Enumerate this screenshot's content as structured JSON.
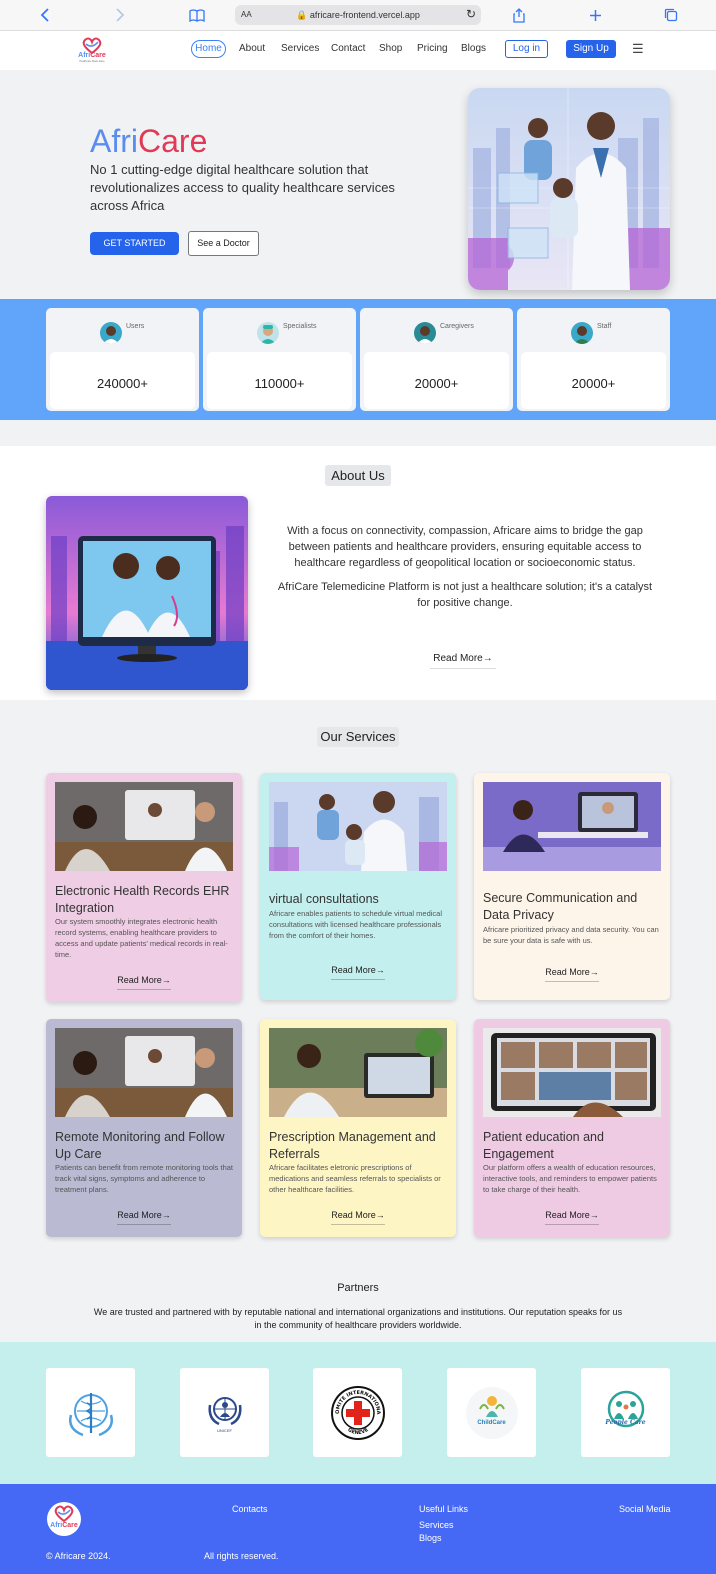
{
  "browser": {
    "text_size_label": "AA",
    "url": "africare-frontend.vercel.app"
  },
  "nav": {
    "logo_text_afri": "Afri",
    "logo_text_care": "Care",
    "logo_tagline": "Healthcare Made Easy",
    "links": [
      "Home",
      "About",
      "Services",
      "Contact",
      "Shop",
      "Pricing",
      "Blogs"
    ],
    "login_label": "Log in",
    "signup_label": "Sign Up"
  },
  "hero": {
    "brand_afri": "Afri",
    "brand_care": "Care",
    "tagline": "No 1 cutting-edge digital healthcare solution that revolutionalizes access to quality healthcare services across Africa",
    "start_label": "GET STARTED",
    "doctor_label": "See a Doctor"
  },
  "stats": [
    {
      "label": "Users",
      "value": "240000+"
    },
    {
      "label": "Specialists",
      "value": "110000+"
    },
    {
      "label": "Caregivers",
      "value": "20000+"
    },
    {
      "label": "Staff",
      "value": "20000+"
    }
  ],
  "about": {
    "title": "About Us",
    "paragraph1": "With a focus on connectivity, compassion, Africare aims to bridge the gap between patients and healthcare providers, ensuring equitable access to healthcare regardless of geopolitical location or socioeconomic status.",
    "paragraph2": "AfriCare Telemedicine Platform is not just a healthcare solution; it's a catalyst for positive change.",
    "read_more": "Read More"
  },
  "services": {
    "title": "Our Services",
    "read_more": "Read More",
    "items": [
      {
        "title": "Electronic Health Records EHR Integration",
        "desc": "Our system smoothly integrates electronic health record systems, enabling healthcare providers to access and update patients' medical records in real-time."
      },
      {
        "title": "virtual consultations",
        "desc": "Africare enables patients to schedule virtual medical consultations with licensed healthcare professionals from the comfort of their homes."
      },
      {
        "title": "Secure Communication and Data Privacy",
        "desc": "Africare prioritized privacy and data security. You can be sure your data is safe with us."
      },
      {
        "title": "Remote Monitoring and Follow Up Care",
        "desc": "Patients can benefit from remote monitoring tools that track vital signs, symptoms and adherence to treatment plans."
      },
      {
        "title": "Prescription Management and Referrals",
        "desc": "Africare facilitates eletronic prescriptions of medications and seamless referrals to specialists or other healthcare facilities."
      },
      {
        "title": "Patient education and Engagement",
        "desc": "Our platform offers a wealth of education resources, interactive tools, and reminders to empower patients to take charge of their health."
      }
    ]
  },
  "partners": {
    "title": "Partners",
    "text": "We are trusted and partnered with by reputable national and international organizations and institutions. Our reputation speaks for us in the community of healthcare providers worldwide.",
    "logos": [
      {
        "name": "WHO",
        "icon": "who-emblem-icon"
      },
      {
        "name": "UNICEF",
        "icon": "unicef-icon",
        "caption": "UNICEF"
      },
      {
        "name": "ICRC",
        "icon": "red-cross-icon",
        "ring_top": "COMITE INTERNATIONAL",
        "ring_bottom": "GENEVE"
      },
      {
        "name": "ChildCare",
        "icon": "childcare-icon",
        "caption": "ChildCare"
      },
      {
        "name": "People Care",
        "icon": "people-care-icon",
        "caption": "People Care"
      }
    ]
  },
  "footer": {
    "contacts_title": "Contacts",
    "useful_links_title": "Useful Links",
    "social_title": "Social Media",
    "links": [
      "Services",
      "Blogs"
    ],
    "copyright": "© Africare 2024.",
    "rights": "All rights reserved.",
    "logo_afri": "Afri",
    "logo_care": "Care"
  },
  "colors": {
    "primary": "#2563eb",
    "brand_blue": "#5b8dee",
    "brand_red": "#e03a56",
    "stats_band": "#60a5fa",
    "partners_band": "#c5efed",
    "footer": "#4569f5",
    "card_pink": "#efcde4",
    "card_cyan": "#c3f0ee",
    "card_cream": "#fdf4ea",
    "card_lavender": "#babad3",
    "card_yellow": "#fef5c5",
    "card_pink2": "#eecbe3"
  }
}
